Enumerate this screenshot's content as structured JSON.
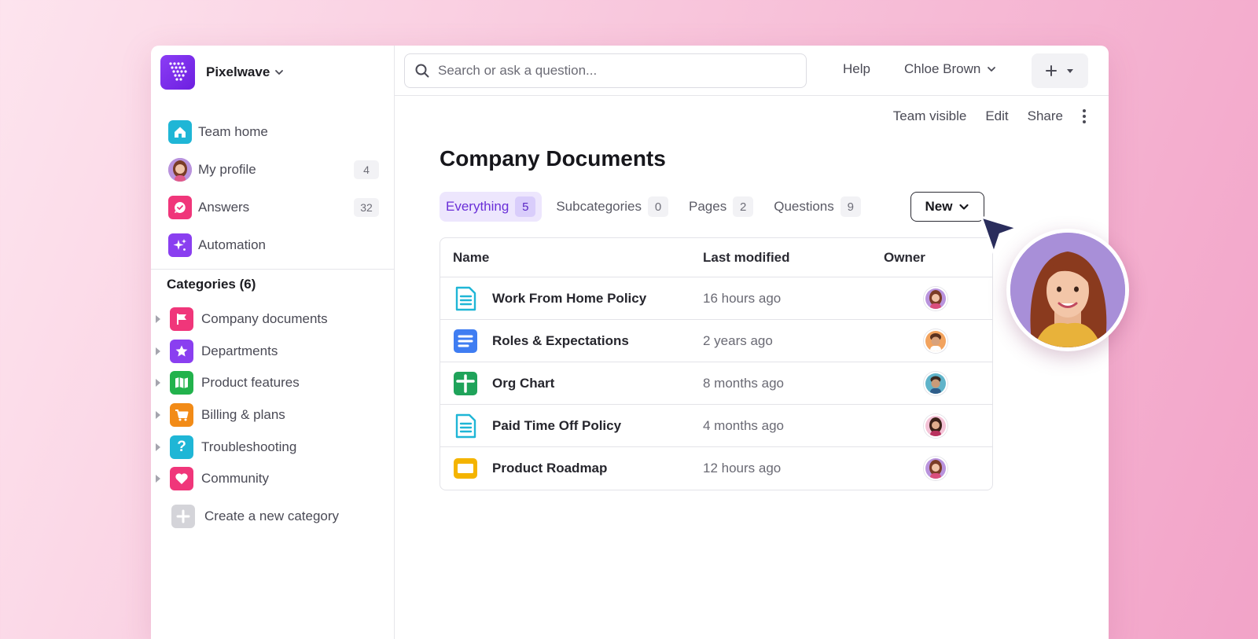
{
  "workspace": {
    "name": "Pixelwave"
  },
  "sidebar": {
    "nav": [
      {
        "label": "Team home",
        "icon": "home-icon",
        "color": "#1fb6d6"
      },
      {
        "label": "My profile",
        "icon": "avatar",
        "count": "4"
      },
      {
        "label": "Answers",
        "icon": "answers-icon",
        "color": "#f0367a",
        "count": "32"
      },
      {
        "label": "Automation",
        "icon": "sparkle-icon",
        "color": "#8a3ff0"
      }
    ],
    "categories_title": "Categories (6)",
    "categories": [
      {
        "label": "Company documents",
        "icon": "flag-icon",
        "color": "#f0367a"
      },
      {
        "label": "Departments",
        "icon": "star-icon",
        "color": "#8a3ff0"
      },
      {
        "label": "Product features",
        "icon": "map-icon",
        "color": "#22b24c"
      },
      {
        "label": "Billing & plans",
        "icon": "cart-icon",
        "color": "#f28b17"
      },
      {
        "label": "Troubleshooting",
        "icon": "question-icon",
        "color": "#1fb6d6"
      },
      {
        "label": "Community",
        "icon": "heart-icon",
        "color": "#f0367a"
      }
    ],
    "create_label": "Create a new category"
  },
  "topbar": {
    "search_placeholder": "Search or ask a question...",
    "help": "Help",
    "user": "Chloe Brown"
  },
  "actions": {
    "visibility": "Team visible",
    "edit": "Edit",
    "share": "Share"
  },
  "page": {
    "title": "Company Documents"
  },
  "tabs": [
    {
      "label": "Everything",
      "count": "5",
      "active": true
    },
    {
      "label": "Subcategories",
      "count": "0"
    },
    {
      "label": "Pages",
      "count": "2"
    },
    {
      "label": "Questions",
      "count": "9"
    }
  ],
  "new_button": "New",
  "table": {
    "headers": {
      "name": "Name",
      "modified": "Last modified",
      "owner": "Owner"
    },
    "rows": [
      {
        "name": "Work From Home Policy",
        "modified": "16 hours ago",
        "icon": "doc-outline-icon"
      },
      {
        "name": "Roles & Expectations",
        "modified": "2 years ago",
        "icon": "doc-icon"
      },
      {
        "name": "Org Chart",
        "modified": "8 months ago",
        "icon": "sheet-icon"
      },
      {
        "name": "Paid Time Off Policy",
        "modified": "4 months ago",
        "icon": "doc-outline-icon"
      },
      {
        "name": "Product Roadmap",
        "modified": "12 hours ago",
        "icon": "slides-icon"
      }
    ]
  },
  "colors": {
    "accent": "#6a2fd8",
    "accent_bg": "#ede6fd"
  }
}
